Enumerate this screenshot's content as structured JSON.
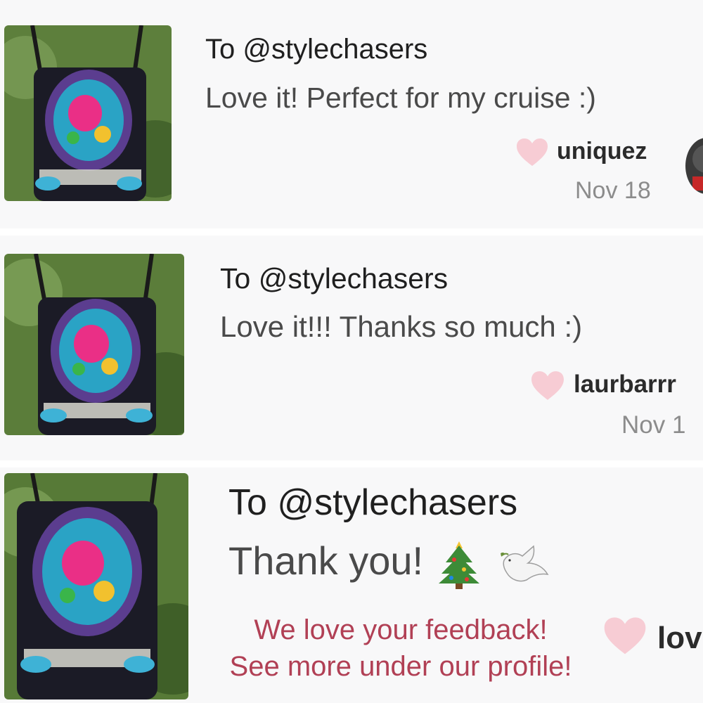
{
  "reviews": [
    {
      "to": "To @stylechasers",
      "message": "Love it! Perfect for my cruise :)",
      "username": "uniquez",
      "date": "Nov 18",
      "product_image": "embroidered-crossbody-bag"
    },
    {
      "to": "To @stylechasers",
      "message": "Love it!!! Thanks so much :)",
      "username": "laurbarrr",
      "date": "Nov 1",
      "product_image": "embroidered-crossbody-bag"
    },
    {
      "to": "To @stylechasers",
      "message": "Thank you!",
      "message_emojis": [
        "christmas-tree-emoji",
        "dove-emoji"
      ],
      "username": "lov",
      "product_image": "embroidered-crossbody-bag"
    }
  ],
  "overlay": {
    "line1": "We love your feedback!",
    "line2": "See more under our profile!"
  },
  "colors": {
    "heart": "#f7ccd4",
    "caption": "#b14055",
    "card_bg": "#f8f8f9"
  },
  "icons": [
    "heart-icon",
    "christmas-tree-emoji",
    "dove-emoji"
  ]
}
